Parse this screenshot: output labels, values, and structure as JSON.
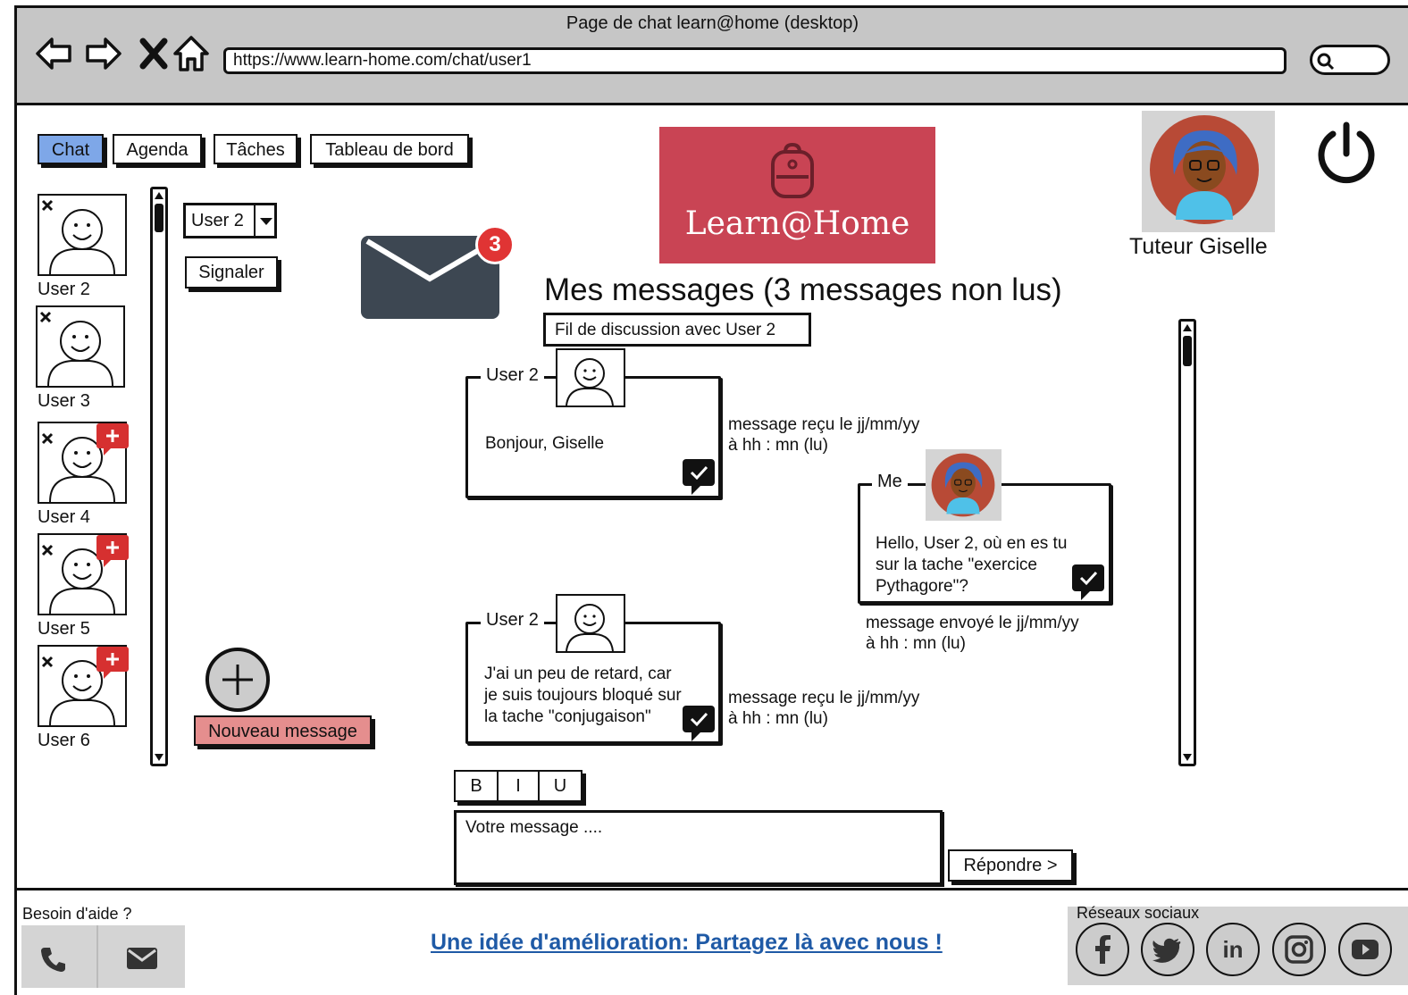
{
  "window": {
    "title": "Page de chat learn@home (desktop)",
    "url": "https://www.learn-home.com/chat/user1"
  },
  "tabs": [
    {
      "label": "Chat"
    },
    {
      "label": "Agenda"
    },
    {
      "label": "Tâches"
    },
    {
      "label": "Tableau de bord"
    }
  ],
  "contacts": [
    {
      "label": "User 2",
      "has_new": false
    },
    {
      "label": "User 3",
      "has_new": false
    },
    {
      "label": "User 4",
      "has_new": true
    },
    {
      "label": "User 5",
      "has_new": true
    },
    {
      "label": "User 6",
      "has_new": true
    }
  ],
  "user_select": {
    "value": "User 2"
  },
  "report_button": "Signaler",
  "mail_badge": "3",
  "new_message_button": "Nouveau message",
  "logo_text": "Learn@Home",
  "profile": {
    "name": "Tuteur Giselle"
  },
  "main": {
    "heading": "Mes messages (3 messages non lus)",
    "thread_label": "Fil de discussion avec User 2"
  },
  "messages": [
    {
      "author": "User 2",
      "text": "Bonjour, Giselle",
      "meta_line1": "message reçu le jj/mm/yy",
      "meta_line2": "à hh : mn (lu)"
    },
    {
      "author": "Me",
      "text_lines": [
        "Hello, User 2, où en es tu",
        "sur la tache \"exercice",
        "Pythagore\"?"
      ],
      "meta_line1": "message envoyé le jj/mm/yy",
      "meta_line2": "à hh : mn (lu)"
    },
    {
      "author": "User 2",
      "text_lines": [
        "J'ai un peu de retard, car",
        "je suis toujours bloqué sur",
        "la tache \"conjugaison\""
      ],
      "meta_line1": "message reçu le jj/mm/yy",
      "meta_line2": "à hh : mn (lu)"
    }
  ],
  "composer": {
    "format_buttons": [
      "B",
      "I",
      "U"
    ],
    "placeholder": "Votre message ....",
    "send_label": "Répondre >"
  },
  "footer": {
    "help_label": "Besoin d'aide ?",
    "feedback_link": "Une idée d'amélioration: Partagez là avec nous !",
    "social_label": "Réseaux sociaux",
    "social_icons": [
      "facebook-icon",
      "twitter-icon",
      "linkedin-icon",
      "instagram-icon",
      "youtube-icon"
    ]
  },
  "colors": {
    "active_tab": "#7ea7e8",
    "logo_bg": "#c94454",
    "badge": "#e03434",
    "new_msg_btn": "#e58e8e",
    "link": "#1f5aa6",
    "mail_icon": "#3d4752"
  }
}
